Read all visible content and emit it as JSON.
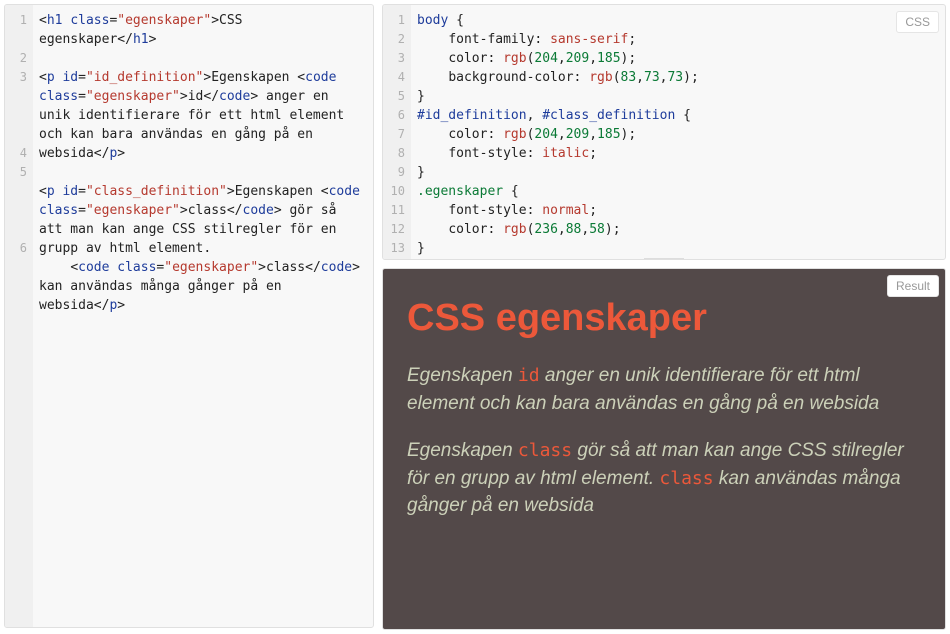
{
  "badges": {
    "css": "CSS",
    "result": "Result"
  },
  "html_editor": {
    "gutter": [
      "1",
      "",
      "2",
      "3",
      "",
      "",
      "",
      "4",
      "5",
      "",
      "",
      "",
      "6",
      "",
      ""
    ],
    "lines": [
      [
        {
          "t": "<",
          "c": "punct"
        },
        {
          "t": "h1",
          "c": "tag"
        },
        {
          "t": " ",
          "c": "txt"
        },
        {
          "t": "class",
          "c": "attr"
        },
        {
          "t": "=",
          "c": "punct"
        },
        {
          "t": "\"egenskaper\"",
          "c": "str"
        },
        {
          "t": ">",
          "c": "punct"
        },
        {
          "t": "CSS egenskaper",
          "c": "txt"
        },
        {
          "t": "</",
          "c": "punct"
        },
        {
          "t": "h1",
          "c": "tag"
        },
        {
          "t": ">",
          "c": "punct"
        }
      ],
      [
        {
          "t": "",
          "c": "txt"
        }
      ],
      [
        {
          "t": "<",
          "c": "punct"
        },
        {
          "t": "p",
          "c": "tag"
        },
        {
          "t": " ",
          "c": "txt"
        },
        {
          "t": "id",
          "c": "attr"
        },
        {
          "t": "=",
          "c": "punct"
        },
        {
          "t": "\"id_definition\"",
          "c": "str"
        },
        {
          "t": ">",
          "c": "punct"
        },
        {
          "t": "Egenskapen ",
          "c": "txt"
        },
        {
          "t": "<",
          "c": "punct"
        },
        {
          "t": "code",
          "c": "tag"
        },
        {
          "t": " ",
          "c": "txt"
        },
        {
          "t": "class",
          "c": "attr"
        },
        {
          "t": "=",
          "c": "punct"
        },
        {
          "t": "\"egenskaper\"",
          "c": "str"
        },
        {
          "t": ">",
          "c": "punct"
        },
        {
          "t": "id",
          "c": "txt"
        },
        {
          "t": "</",
          "c": "punct"
        },
        {
          "t": "code",
          "c": "tag"
        },
        {
          "t": ">",
          "c": "punct"
        },
        {
          "t": " anger en unik identifierare för ett html element och kan bara användas en gång på en websida",
          "c": "txt"
        },
        {
          "t": "</",
          "c": "punct"
        },
        {
          "t": "p",
          "c": "tag"
        },
        {
          "t": ">",
          "c": "punct"
        }
      ],
      [
        {
          "t": "",
          "c": "txt"
        }
      ],
      [
        {
          "t": "<",
          "c": "punct"
        },
        {
          "t": "p",
          "c": "tag"
        },
        {
          "t": " ",
          "c": "txt"
        },
        {
          "t": "id",
          "c": "attr"
        },
        {
          "t": "=",
          "c": "punct"
        },
        {
          "t": "\"class_definition\"",
          "c": "str"
        },
        {
          "t": ">",
          "c": "punct"
        },
        {
          "t": "Egenskapen ",
          "c": "txt"
        },
        {
          "t": "<",
          "c": "punct"
        },
        {
          "t": "code",
          "c": "tag"
        },
        {
          "t": " ",
          "c": "txt"
        },
        {
          "t": "class",
          "c": "attr"
        },
        {
          "t": "=",
          "c": "punct"
        },
        {
          "t": "\"egenskaper\"",
          "c": "str"
        },
        {
          "t": ">",
          "c": "punct"
        },
        {
          "t": "class",
          "c": "txt"
        },
        {
          "t": "</",
          "c": "punct"
        },
        {
          "t": "code",
          "c": "tag"
        },
        {
          "t": ">",
          "c": "punct"
        },
        {
          "t": " gör så att man kan ange CSS stilregler för en grupp av html element.",
          "c": "txt"
        }
      ],
      [
        {
          "t": "    ",
          "c": "txt"
        },
        {
          "t": "<",
          "c": "punct"
        },
        {
          "t": "code",
          "c": "tag"
        },
        {
          "t": " ",
          "c": "txt"
        },
        {
          "t": "class",
          "c": "attr"
        },
        {
          "t": "=",
          "c": "punct"
        },
        {
          "t": "\"egenskaper\"",
          "c": "str"
        },
        {
          "t": ">",
          "c": "punct"
        },
        {
          "t": "class",
          "c": "txt"
        },
        {
          "t": "</",
          "c": "punct"
        },
        {
          "t": "code",
          "c": "tag"
        },
        {
          "t": ">",
          "c": "punct"
        },
        {
          "t": " kan användas många gånger på en websida",
          "c": "txt"
        },
        {
          "t": "</",
          "c": "punct"
        },
        {
          "t": "p",
          "c": "tag"
        },
        {
          "t": ">",
          "c": "punct"
        }
      ]
    ]
  },
  "css_editor": {
    "gutter": [
      "1",
      "2",
      "3",
      "4",
      "5",
      "6",
      "7",
      "8",
      "9",
      "10",
      "11",
      "12",
      "13"
    ],
    "lines": [
      [
        {
          "t": "body",
          "c": "sel"
        },
        {
          "t": " {",
          "c": "punct"
        }
      ],
      [
        {
          "t": "    ",
          "c": "txt"
        },
        {
          "t": "font-family",
          "c": "prop"
        },
        {
          "t": ": ",
          "c": "punct"
        },
        {
          "t": "sans-serif",
          "c": "kw"
        },
        {
          "t": ";",
          "c": "punct"
        }
      ],
      [
        {
          "t": "    ",
          "c": "txt"
        },
        {
          "t": "color",
          "c": "prop"
        },
        {
          "t": ": ",
          "c": "punct"
        },
        {
          "t": "rgb",
          "c": "fn"
        },
        {
          "t": "(",
          "c": "punct"
        },
        {
          "t": "204",
          "c": "num"
        },
        {
          "t": ",",
          "c": "punct"
        },
        {
          "t": "209",
          "c": "num"
        },
        {
          "t": ",",
          "c": "punct"
        },
        {
          "t": "185",
          "c": "num"
        },
        {
          "t": ");",
          "c": "punct"
        }
      ],
      [
        {
          "t": "    ",
          "c": "txt"
        },
        {
          "t": "background-color",
          "c": "prop"
        },
        {
          "t": ": ",
          "c": "punct"
        },
        {
          "t": "rgb",
          "c": "fn"
        },
        {
          "t": "(",
          "c": "punct"
        },
        {
          "t": "83",
          "c": "num"
        },
        {
          "t": ",",
          "c": "punct"
        },
        {
          "t": "73",
          "c": "num"
        },
        {
          "t": ",",
          "c": "punct"
        },
        {
          "t": "73",
          "c": "num"
        },
        {
          "t": ");",
          "c": "punct"
        }
      ],
      [
        {
          "t": "}",
          "c": "punct"
        }
      ],
      [
        {
          "t": "#id_definition",
          "c": "idsel"
        },
        {
          "t": ", ",
          "c": "punct"
        },
        {
          "t": "#class_definition",
          "c": "idsel"
        },
        {
          "t": " {",
          "c": "punct"
        }
      ],
      [
        {
          "t": "    ",
          "c": "txt"
        },
        {
          "t": "color",
          "c": "prop"
        },
        {
          "t": ": ",
          "c": "punct"
        },
        {
          "t": "rgb",
          "c": "fn"
        },
        {
          "t": "(",
          "c": "punct"
        },
        {
          "t": "204",
          "c": "num"
        },
        {
          "t": ",",
          "c": "punct"
        },
        {
          "t": "209",
          "c": "num"
        },
        {
          "t": ",",
          "c": "punct"
        },
        {
          "t": "185",
          "c": "num"
        },
        {
          "t": ");",
          "c": "punct"
        }
      ],
      [
        {
          "t": "    ",
          "c": "txt"
        },
        {
          "t": "font-style",
          "c": "prop"
        },
        {
          "t": ": ",
          "c": "punct"
        },
        {
          "t": "italic",
          "c": "kw"
        },
        {
          "t": ";",
          "c": "punct"
        }
      ],
      [
        {
          "t": "}",
          "c": "punct"
        }
      ],
      [
        {
          "t": ".egenskaper",
          "c": "class-sel"
        },
        {
          "t": " {",
          "c": "punct"
        }
      ],
      [
        {
          "t": "    ",
          "c": "txt"
        },
        {
          "t": "font-style",
          "c": "prop"
        },
        {
          "t": ": ",
          "c": "punct"
        },
        {
          "t": "normal",
          "c": "kw"
        },
        {
          "t": ";",
          "c": "punct"
        }
      ],
      [
        {
          "t": "    ",
          "c": "txt"
        },
        {
          "t": "color",
          "c": "prop"
        },
        {
          "t": ": ",
          "c": "punct"
        },
        {
          "t": "rgb",
          "c": "fn"
        },
        {
          "t": "(",
          "c": "punct"
        },
        {
          "t": "236",
          "c": "num"
        },
        {
          "t": ",",
          "c": "punct"
        },
        {
          "t": "88",
          "c": "num"
        },
        {
          "t": ",",
          "c": "punct"
        },
        {
          "t": "58",
          "c": "num"
        },
        {
          "t": ");",
          "c": "punct"
        }
      ],
      [
        {
          "t": "}",
          "c": "punct"
        }
      ]
    ]
  },
  "result": {
    "h1": "CSS egenskaper",
    "p1_a": "Egenskapen ",
    "p1_code": "id",
    "p1_b": " anger en unik identifierare för ett html element och kan bara användas en gång på en websida",
    "p2_a": "Egenskapen ",
    "p2_code1": "class",
    "p2_b": " gör så att man kan ange CSS stilregler för en grupp av html element. ",
    "p2_code2": "class",
    "p2_c": " kan användas många gånger på en websida"
  }
}
